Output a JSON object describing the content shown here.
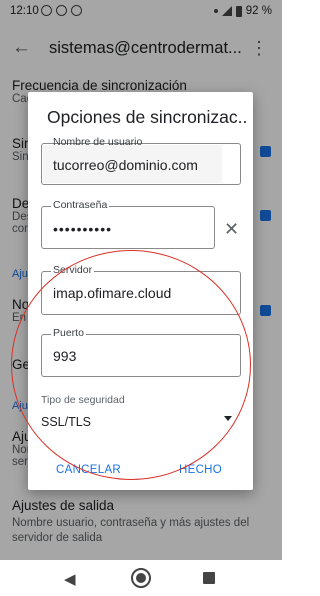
{
  "status_bar": {
    "time": "12:10",
    "battery": "92 %"
  },
  "app_bar": {
    "title": "sistemas@centrodermat..."
  },
  "background_settings": [
    {
      "title": "Frecuencia de sincronización",
      "subtitle": "Cad"
    },
    {
      "title": "Sin",
      "subtitle": "Sin"
    },
    {
      "title": "Des",
      "subtitle": "Des"
    },
    {
      "title": "",
      "subtitle": "con"
    },
    {
      "title": "No",
      "subtitle": "En"
    },
    {
      "title": "Ge",
      "subtitle": ""
    },
    {
      "title": "Aju",
      "subtitle": "Nor"
    },
    {
      "title": "",
      "subtitle": "ser"
    }
  ],
  "section_headers": [
    "Aju",
    "Aju"
  ],
  "salida": {
    "title": "Ajustes de salida",
    "subtitle": "Nombre usuario, contraseña y más ajustes del servidor de salida"
  },
  "dialog": {
    "title": "Opciones de sincronizac...",
    "username": {
      "label": "Nombre de usuario",
      "value": "tucorreo@dominio.com"
    },
    "password": {
      "label": "Contraseña",
      "value": "••••••••••"
    },
    "server": {
      "label": "Servidor",
      "value": "imap.ofimare.cloud"
    },
    "port": {
      "label": "Puerto",
      "value": "993"
    },
    "security": {
      "label": "Tipo de seguridad",
      "value": "SSL/TLS"
    },
    "buttons": {
      "cancel": "CANCELAR",
      "done": "HECHO"
    }
  },
  "colors": {
    "accent": "#1a73e8",
    "annotation": "#d93025"
  },
  "icons": [
    "back-arrow-icon",
    "overflow-menu-icon",
    "clear-icon",
    "dropdown-arrow-icon",
    "nav-back-icon",
    "nav-home-icon",
    "nav-recent-icon"
  ]
}
